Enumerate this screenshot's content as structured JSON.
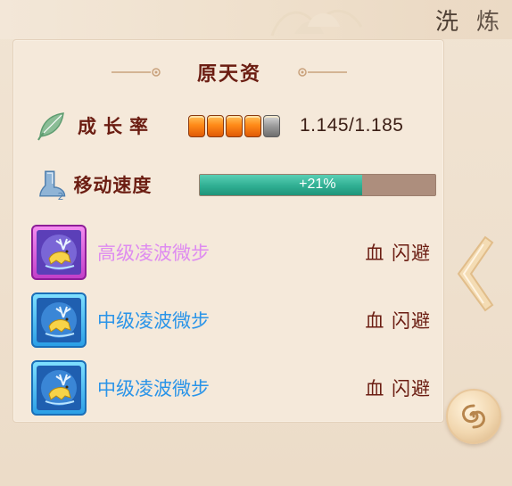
{
  "header": {
    "tab_chars": [
      "洗",
      "炼"
    ]
  },
  "panel": {
    "title": "原天资"
  },
  "growth": {
    "label": "成长率",
    "value": "1.145/1.185",
    "pips_filled": 4,
    "pips_total": 5
  },
  "speed": {
    "label": "移动速度",
    "bar_text": "+21%",
    "fill_fraction": 0.69
  },
  "skills": [
    {
      "name": "高级凌波微步",
      "attr": "血 闪避",
      "tier_color": "#de8bf0"
    },
    {
      "name": "中级凌波微步",
      "attr": "血 闪避",
      "tier_color": "#2a94e8"
    },
    {
      "name": "中级凌波微步",
      "attr": "血 闪避",
      "tier_color": "#2a94e8"
    }
  ],
  "icons": {
    "growth": "leaf-icon",
    "speed": "boot-icon",
    "skill": "deer-skill-icon",
    "nav": "chevron-left-icon",
    "action": "swirl-icon"
  },
  "colors": {
    "title": "#6b1d12",
    "speed_fill": "#2fae92",
    "pip_filled": "#ff8a18",
    "pip_empty": "#9a9a9a"
  }
}
